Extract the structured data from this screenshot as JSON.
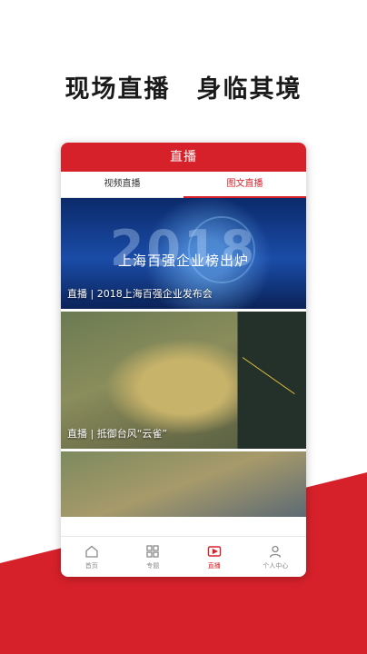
{
  "headline": "现场直播　身临其境",
  "app": {
    "title": "直播",
    "tabs": [
      {
        "label": "视频直播",
        "active": false
      },
      {
        "label": "图文直播",
        "active": true
      }
    ],
    "feed": [
      {
        "caption": "直播 | 2018上海百强企业发布会",
        "year_text": "2018",
        "banner_text": "上海百强企业榜出炉"
      },
      {
        "caption": "直播 | 抵御台风“云雀”"
      },
      {
        "caption": ""
      }
    ],
    "nav": [
      {
        "label": "首页",
        "icon": "home-icon",
        "active": false
      },
      {
        "label": "专题",
        "icon": "grid-icon",
        "active": false
      },
      {
        "label": "直播",
        "icon": "live-icon",
        "active": true
      },
      {
        "label": "个人中心",
        "icon": "user-icon",
        "active": false
      }
    ]
  },
  "colors": {
    "accent": "#d7212a",
    "inactive": "#8a8a8a"
  }
}
